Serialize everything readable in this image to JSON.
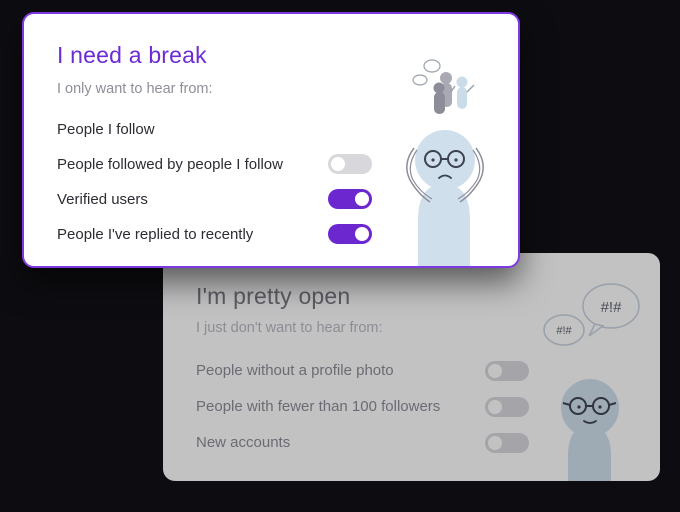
{
  "back_card": {
    "title": "I'm pretty open",
    "subtitle": "I just don't want to hear from:",
    "items": [
      {
        "label": "People without a profile photo",
        "enabled": false
      },
      {
        "label": "People with fewer than 100 followers",
        "enabled": false
      },
      {
        "label": "New accounts",
        "enabled": false
      }
    ],
    "bubble_text_1": "#!#",
    "bubble_text_2": "#!#"
  },
  "front_card": {
    "title": "I need a break",
    "subtitle": "I only want to hear from:",
    "items": [
      {
        "label": "People I follow"
      },
      {
        "label": "People followed by people I follow",
        "enabled": false
      },
      {
        "label": "Verified users",
        "enabled": true
      },
      {
        "label": "People I've replied to recently",
        "enabled": true
      }
    ]
  },
  "colors": {
    "accent": "#6c27cf",
    "title_front": "#6c2bd6",
    "text_dark": "#2c2c33",
    "text_muted_back": "#8b8b96",
    "toggle_off": "#d8d8dc",
    "figure": "#cfe0ec"
  }
}
